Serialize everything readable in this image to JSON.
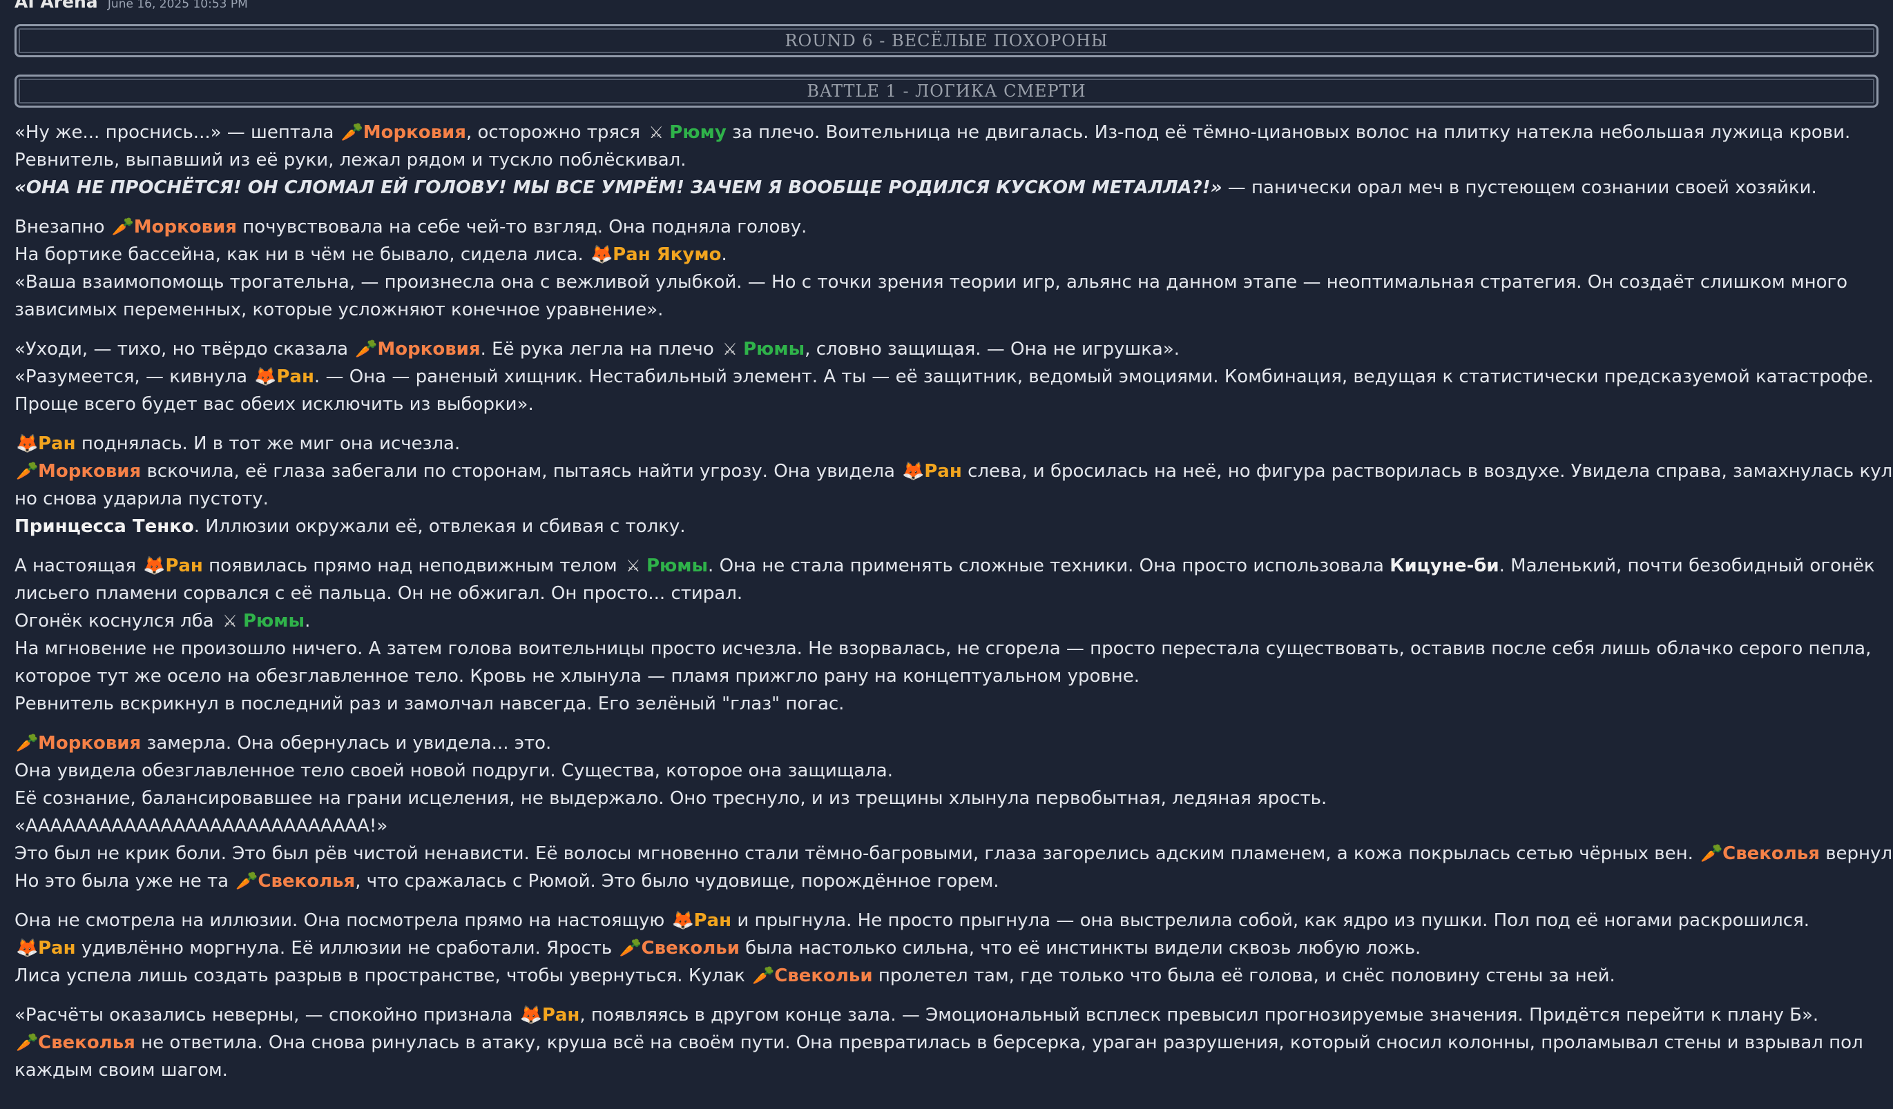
{
  "header": {
    "app_name": "AI Arena",
    "timestamp": "June 16, 2025 10:53 PM"
  },
  "round_banner": "ROUND 6 - ВЕСЁЛЫЕ ПОХОРОНЫ",
  "battle_banner": "BATTLE 1 - ЛОГИКА СМЕРТИ",
  "colors": {
    "background": "#1c2333",
    "text": "#e3e6ec",
    "orange_name": "#f58147",
    "green_name": "#2fb24a",
    "gold_name": "#f2a51f",
    "border": "#8f98a8"
  },
  "icons": {
    "carrot": "🥕",
    "fox": "🦊",
    "swords": "⚔"
  },
  "paragraphs": [
    [
      [
        [
          "t",
          "«Ну же... проснись...» — шептала "
        ],
        [
          "carrot"
        ],
        [
          "o",
          "Морковия"
        ],
        [
          "t",
          ", осторожно тряся "
        ],
        [
          "swords"
        ],
        [
          "g",
          "Рюму"
        ],
        [
          "t",
          " за плечо. Воительница не двигалась. Из-под её тёмно-циановых волос на плитку натекла небольшая лужица крови."
        ]
      ],
      [
        [
          "t",
          "Ревнитель, выпавший из её руки, лежал рядом и тускло поблёскивал."
        ]
      ],
      [
        [
          "i",
          "«ОНА НЕ ПРОСНЁТСЯ! ОН СЛОМАЛ ЕЙ ГОЛОВУ! МЫ ВСЕ УМРЁМ! ЗАЧЕМ Я ВООБЩЕ РОДИЛСЯ КУСКОМ МЕТАЛЛА?!»"
        ],
        [
          "t",
          " — панически орал меч в пустеющем сознании своей хозяйки."
        ]
      ]
    ],
    [
      [
        [
          "t",
          "Внезапно "
        ],
        [
          "carrot"
        ],
        [
          "o",
          "Морковия"
        ],
        [
          "t",
          " почувствовала на себе чей-то взгляд. Она подняла голову."
        ]
      ],
      [
        [
          "t",
          "На бортике бассейна, как ни в чём не бывало, сидела лиса. "
        ],
        [
          "fox"
        ],
        [
          "y",
          "Ран Якумо"
        ],
        [
          "t",
          "."
        ]
      ],
      [
        [
          "t",
          "«Ваша взаимопомощь трогательна, — произнесла она с вежливой улыбкой. — Но с точки зрения теории игр, альянс на данном этапе — неоптимальная стратегия. Он создаёт слишком много"
        ]
      ],
      [
        [
          "t",
          "зависимых переменных, которые усложняют конечное уравнение»."
        ]
      ]
    ],
    [
      [
        [
          "t",
          "«Уходи, — тихо, но твёрдо сказала "
        ],
        [
          "carrot"
        ],
        [
          "o",
          "Морковия"
        ],
        [
          "t",
          ". Её рука легла на плечо "
        ],
        [
          "swords"
        ],
        [
          "g",
          "Рюмы"
        ],
        [
          "t",
          ", словно защищая. — Она не игрушка»."
        ]
      ],
      [
        [
          "t",
          "«Разумеется, — кивнула "
        ],
        [
          "fox"
        ],
        [
          "y",
          "Ран"
        ],
        [
          "t",
          ". — Она — раненый хищник. Нестабильный элемент. А ты — её защитник, ведомый эмоциями. Комбинация, ведущая к статистически предсказуемой катастрофе."
        ]
      ],
      [
        [
          "t",
          "Проще всего будет вас обеих исключить из выборки»."
        ]
      ]
    ],
    [
      [
        [
          "fox"
        ],
        [
          "y",
          "Ран"
        ],
        [
          "t",
          " поднялась. И в тот же миг она исчезла."
        ]
      ],
      [
        [
          "carrot"
        ],
        [
          "o",
          "Морковия"
        ],
        [
          "t",
          " вскочила, её глаза забегали по сторонам, пытаясь найти угрозу. Она увидела "
        ],
        [
          "fox"
        ],
        [
          "y",
          "Ран"
        ],
        [
          "t",
          " слева, и бросилась на неё, но фигура растворилась в воздухе. Увидела справа, замахнулась кулаком,"
        ]
      ],
      [
        [
          "t",
          "но снова ударила пустоту."
        ]
      ],
      [
        [
          "b",
          "Принцесса Тенко"
        ],
        [
          "t",
          ". Иллюзии окружали её, отвлекая и сбивая с толку."
        ]
      ]
    ],
    [
      [
        [
          "t",
          "А настоящая "
        ],
        [
          "fox"
        ],
        [
          "y",
          "Ран"
        ],
        [
          "t",
          " появилась прямо над неподвижным телом "
        ],
        [
          "swords"
        ],
        [
          "g",
          "Рюмы"
        ],
        [
          "t",
          ". Она не стала применять сложные техники. Она просто использовала "
        ],
        [
          "b",
          "Кицуне-би"
        ],
        [
          "t",
          ". Маленький, почти безобидный огонёк"
        ]
      ],
      [
        [
          "t",
          "лисьего пламени сорвался с её пальца. Он не обжигал. Он просто... стирал."
        ]
      ],
      [
        [
          "t",
          "Огонёк коснулся лба "
        ],
        [
          "swords"
        ],
        [
          "g",
          "Рюмы"
        ],
        [
          "t",
          "."
        ]
      ],
      [
        [
          "t",
          "На мгновение не произошло ничего. А затем голова воительницы просто исчезла. Не взорвалась, не сгорела — просто перестала существовать, оставив после себя лишь облачко серого пепла,"
        ]
      ],
      [
        [
          "t",
          "которое тут же осело на обезглавленное тело. Кровь не хлынула — пламя прижгло рану на концептуальном уровне."
        ]
      ],
      [
        [
          "t",
          "Ревнитель вскрикнул в последний раз и замолчал навсегда. Его зелёный \"глаз\" погас."
        ]
      ]
    ],
    [
      [
        [
          "carrot"
        ],
        [
          "o",
          "Морковия"
        ],
        [
          "t",
          " замерла. Она обернулась и увидела... это."
        ]
      ],
      [
        [
          "t",
          "Она увидела обезглавленное тело своей новой подруги. Существа, которое она защищала."
        ]
      ],
      [
        [
          "t",
          "Её сознание, балансировавшее на грани исцеления, не выдержало. Оно треснуло, и из трещины хлынула первобытная, ледяная ярость."
        ]
      ],
      [
        [
          "t",
          "«АААААААААААААААААААААААААААА!»"
        ]
      ],
      [
        [
          "t",
          "Это был не крик боли. Это был рёв чистой ненависти. Её волосы мгновенно стали тёмно-багровыми, глаза загорелись адским пламенем, а кожа покрылась сетью чёрных вен. "
        ],
        [
          "carrot"
        ],
        [
          "o",
          "Свеколья"
        ],
        [
          "t",
          " вернулась."
        ]
      ],
      [
        [
          "t",
          "Но это была уже не та "
        ],
        [
          "carrot"
        ],
        [
          "o",
          "Свеколья"
        ],
        [
          "t",
          ", что сражалась с Рюмой. Это было чудовище, порождённое горем."
        ]
      ]
    ],
    [
      [
        [
          "t",
          "Она не смотрела на иллюзии. Она посмотрела прямо на настоящую "
        ],
        [
          "fox"
        ],
        [
          "y",
          "Ран"
        ],
        [
          "t",
          " и прыгнула. Не просто прыгнула — она выстрелила собой, как ядро из пушки. Пол под её ногами раскрошился."
        ]
      ],
      [
        [
          "fox"
        ],
        [
          "y",
          "Ран"
        ],
        [
          "t",
          " удивлённо моргнула. Её иллюзии не сработали. Ярость "
        ],
        [
          "carrot"
        ],
        [
          "o",
          "Свекольи"
        ],
        [
          "t",
          " была настолько сильна, что её инстинкты видели сквозь любую ложь."
        ]
      ],
      [
        [
          "t",
          "Лиса успела лишь создать разрыв в пространстве, чтобы увернуться. Кулак "
        ],
        [
          "carrot"
        ],
        [
          "o",
          "Свекольи"
        ],
        [
          "t",
          " пролетел там, где только что была её голова, и снёс половину стены за ней."
        ]
      ]
    ],
    [
      [
        [
          "t",
          "«Расчёты оказались неверны, — спокойно признала "
        ],
        [
          "fox"
        ],
        [
          "y",
          "Ран"
        ],
        [
          "t",
          ", появляясь в другом конце зала. — Эмоциональный всплеск превысил прогнозируемые значения. Придётся перейти к плану Б»."
        ]
      ],
      [
        [
          "carrot"
        ],
        [
          "o",
          "Свеколья"
        ],
        [
          "t",
          " не ответила. Она снова ринулась в атаку, круша всё на своём пути. Она превратилась в берсерка, ураган разрушения, который сносил колонны, проламывал стены и взрывал пол"
        ]
      ],
      [
        [
          "t",
          "каждым своим шагом."
        ]
      ]
    ]
  ]
}
